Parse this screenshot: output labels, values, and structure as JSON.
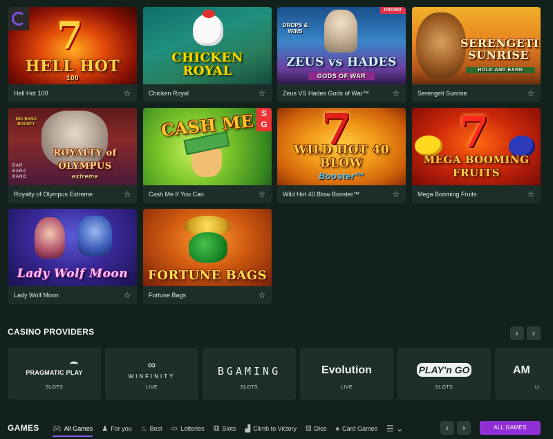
{
  "games": [
    {
      "name": "Hell Hot 100",
      "art_title": "HELL HOT",
      "art_sub": "100",
      "favorite_icon": "star-outline-icon"
    },
    {
      "name": "Chicken Royal",
      "art_title": "CHICKEN ROYAL",
      "art_sub": "",
      "favorite_icon": "star-outline-icon"
    },
    {
      "name": "Zeus VS Hades Gods of War™",
      "art_title": "ZEUS vs HADES",
      "art_sub": "GODS OF WAR",
      "promo": "PROMO",
      "art_badge": "DROPS & WINS",
      "favorite_icon": "star-outline-icon"
    },
    {
      "name": "Serengeti Sunrise",
      "art_title": "SERENGETI SUNRISE",
      "art_sub": "HOLD AND EARN",
      "favorite_icon": "star-outline-icon"
    },
    {
      "name": "Royalty of Olympus Extreme",
      "art_title": "ROYALTY of OLYMPUS",
      "art_sub": "extreme",
      "art_badge": "BIG BANG BOUNTY",
      "art_side": "BAR BARA BANG",
      "favorite_icon": "star-outline-icon"
    },
    {
      "name": "Cash Me If You Can",
      "art_title": "CASH ME",
      "art_sub": "",
      "favorite_icon": "star-outline-icon"
    },
    {
      "name": "Wild Hot 40 Blow Booster™",
      "art_title": "WILD HOT 40 BLOW",
      "art_sub": "Booster™",
      "favorite_icon": "star-outline-icon"
    },
    {
      "name": "Mega Booming Fruits",
      "art_title": "MEGA BOOMING FRUITS",
      "art_sub": "",
      "favorite_icon": "star-outline-icon"
    },
    {
      "name": "Lady Wolf Moon",
      "art_title": "Lady Wolf Moon",
      "art_sub": "",
      "favorite_icon": "star-outline-icon"
    },
    {
      "name": "Fortune Bags",
      "art_title": "FORTUNE BAGS",
      "art_sub": "",
      "favorite_icon": "star-outline-icon"
    }
  ],
  "providers_section": {
    "title": "CASINO PROVIDERS",
    "prev_icon": "chevron-left-icon",
    "next_icon": "chevron-right-icon",
    "items": [
      {
        "logo": "PRAGMATIC PLAY",
        "tag": "SLOTS"
      },
      {
        "logo": "WINFINITY",
        "tag": "LIVE"
      },
      {
        "logo": "BGAMING",
        "tag": "SLOTS"
      },
      {
        "logo": "Evolution",
        "tag": "LIVE"
      },
      {
        "logo": "PLAY'n GO",
        "tag": "SLOTS"
      },
      {
        "logo": "AM",
        "tag": "LI"
      }
    ]
  },
  "games_bar": {
    "title": "GAMES",
    "tabs": [
      {
        "label": "All Games",
        "icon": "gamepad-icon",
        "active": true
      },
      {
        "label": "For you",
        "icon": "person-icon"
      },
      {
        "label": "Best",
        "icon": "flame-icon"
      },
      {
        "label": "Lotteries",
        "icon": "ticket-icon"
      },
      {
        "label": "Slots",
        "icon": "slot-machine-icon"
      },
      {
        "label": "Climb to Victory",
        "icon": "bar-chart-icon"
      },
      {
        "label": "Dice",
        "icon": "dice-icon"
      },
      {
        "label": "Card Games",
        "icon": "spade-icon"
      }
    ],
    "more_icon": "list-dropdown-icon",
    "all_games_button": "ALL GAMES"
  },
  "colors": {
    "background": "#13211d",
    "card": "#1d2e29",
    "accent_purple": "#8f2fd6",
    "promo_red": "#e0344a"
  }
}
